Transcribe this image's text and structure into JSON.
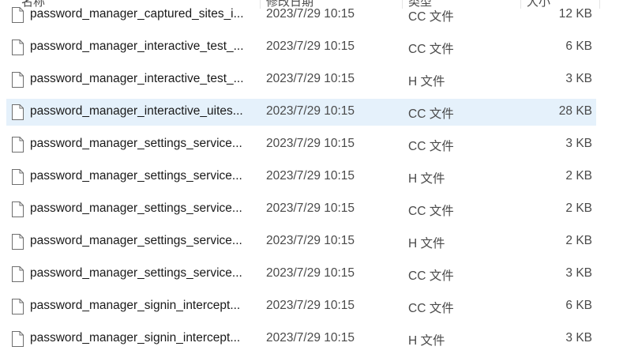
{
  "columns": {
    "name": "名称",
    "date": "修改日期",
    "type": "类型",
    "size": "大小"
  },
  "files": [
    {
      "name": "password_manager_captured_sites_i...",
      "date": "2023/7/29 10:15",
      "type": "CC 文件",
      "size": "12 KB"
    },
    {
      "name": "password_manager_interactive_test_...",
      "date": "2023/7/29 10:15",
      "type": "CC 文件",
      "size": "6 KB"
    },
    {
      "name": "password_manager_interactive_test_...",
      "date": "2023/7/29 10:15",
      "type": "H 文件",
      "size": "3 KB"
    },
    {
      "name": "password_manager_interactive_uites...",
      "date": "2023/7/29 10:15",
      "type": "CC 文件",
      "size": "28 KB",
      "selected": true
    },
    {
      "name": "password_manager_settings_service...",
      "date": "2023/7/29 10:15",
      "type": "CC 文件",
      "size": "3 KB"
    },
    {
      "name": "password_manager_settings_service...",
      "date": "2023/7/29 10:15",
      "type": "H 文件",
      "size": "2 KB"
    },
    {
      "name": "password_manager_settings_service...",
      "date": "2023/7/29 10:15",
      "type": "CC 文件",
      "size": "2 KB"
    },
    {
      "name": "password_manager_settings_service...",
      "date": "2023/7/29 10:15",
      "type": "H 文件",
      "size": "2 KB"
    },
    {
      "name": "password_manager_settings_service...",
      "date": "2023/7/29 10:15",
      "type": "CC 文件",
      "size": "3 KB"
    },
    {
      "name": "password_manager_signin_intercept...",
      "date": "2023/7/29 10:15",
      "type": "CC 文件",
      "size": "6 KB"
    },
    {
      "name": "password_manager_signin_intercept...",
      "date": "2023/7/29 10:15",
      "type": "H 文件",
      "size": "3 KB"
    }
  ],
  "icons": {
    "file": "file-icon"
  },
  "colors": {
    "selected_row": "#e5f1fb"
  }
}
